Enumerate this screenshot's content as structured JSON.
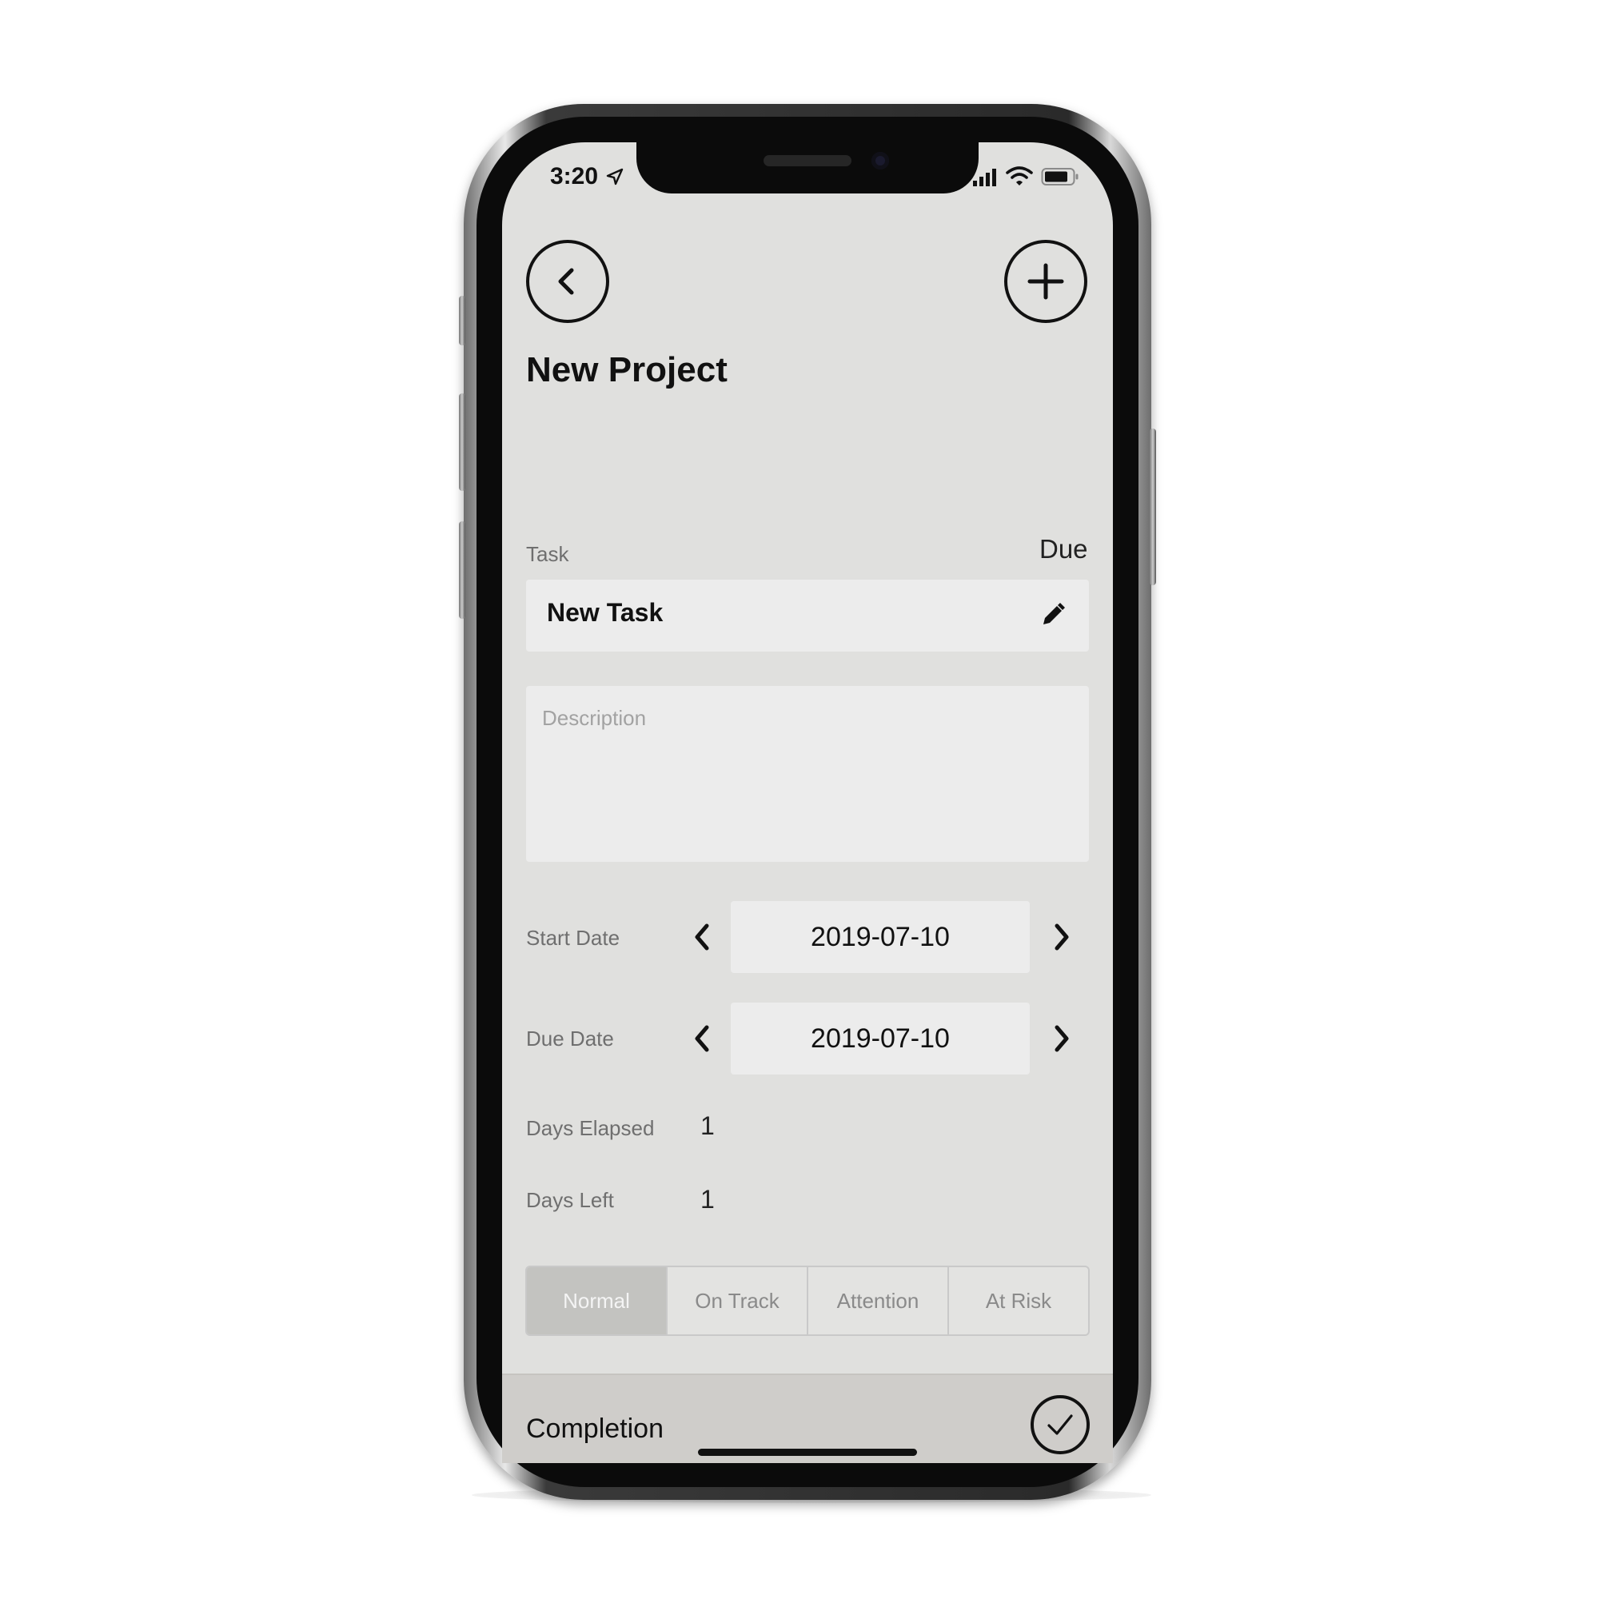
{
  "status_bar": {
    "time": "3:20",
    "icons": [
      "location-arrow-icon",
      "signal-bars-icon",
      "wifi-icon",
      "battery-icon"
    ]
  },
  "header": {
    "back_icon": "chevron-left-icon",
    "add_icon": "plus-icon",
    "title": "New Project"
  },
  "task": {
    "label": "Task",
    "due_label": "Due",
    "name": "New Task",
    "edit_icon": "pencil-icon",
    "description_placeholder": "Description"
  },
  "dates": {
    "start_label": "Start Date",
    "start_value": "2019-07-10",
    "due_label": "Due Date",
    "due_value": "2019-07-10"
  },
  "stats": {
    "days_elapsed_label": "Days Elapsed",
    "days_elapsed_value": "1",
    "days_left_label": "Days Left",
    "days_left_value": "1"
  },
  "status_segments": {
    "options": [
      "Normal",
      "On Track",
      "Attention",
      "At Risk"
    ],
    "selected": "Normal"
  },
  "completion": {
    "label": "Completion",
    "icon": "checkmark-circle-icon"
  },
  "colors": {
    "screen_background": "#e0e0de",
    "field_background": "#ececec",
    "segment_active": "#c3c3c0",
    "bottom_bar": "#cfcdca",
    "text_primary": "#111111",
    "text_label": "#6f6f6f"
  }
}
